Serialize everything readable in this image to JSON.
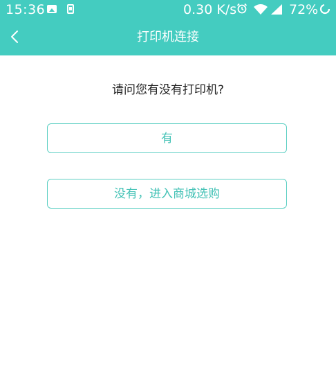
{
  "status_bar": {
    "time": "15:36",
    "network_speed": "0.30 K/s",
    "battery": "72%"
  },
  "nav": {
    "title": "打印机连接"
  },
  "main": {
    "question": "请问您有没有打印机?",
    "yes_label": "有",
    "no_label": "没有，进入商城选购"
  },
  "colors": {
    "accent": "#44ccc0",
    "button_border": "#5ccfc3",
    "button_text": "#44c2b6",
    "text": "#222222"
  },
  "icons": {
    "back": "chevron-left-icon",
    "image": "image-icon",
    "phone": "phone-icon",
    "alarm": "alarm-icon",
    "wifi": "wifi-icon",
    "signal": "signal-icon",
    "battery": "battery-ring-icon"
  }
}
